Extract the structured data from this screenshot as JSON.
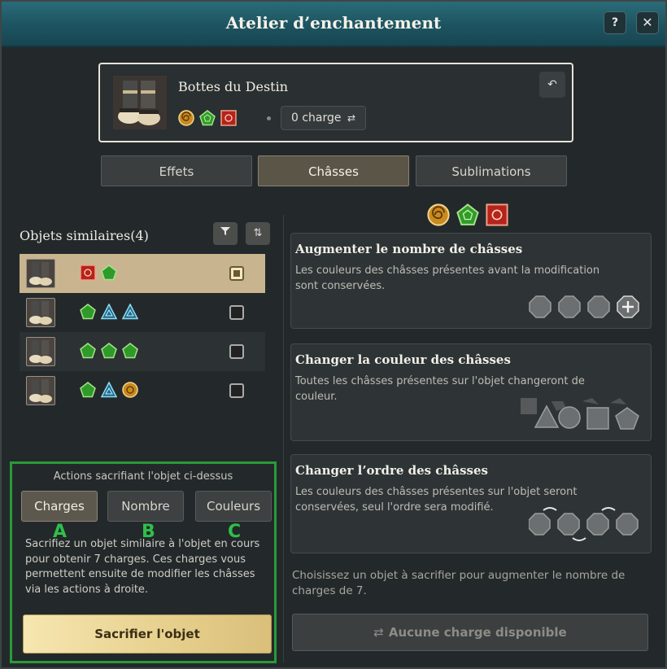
{
  "window": {
    "title": "Atelier d’enchantement",
    "help_label": "?",
    "close_label": "✕"
  },
  "item": {
    "name": "Bottes du Destin",
    "icon": "boots-icon",
    "sockets": [
      "orange-spiral",
      "green-pentagon",
      "red-square"
    ],
    "charge_label": "0 charge",
    "undo_icon": "undo-icon"
  },
  "tabs": [
    {
      "label": "Effets",
      "active": false
    },
    {
      "label": "Châsses",
      "active": true
    },
    {
      "label": "Sublimations",
      "active": false
    }
  ],
  "similar": {
    "title": "Objets similaires(4)",
    "filter_icon": "filter-icon",
    "sort_icon": "sort-icon",
    "items": [
      {
        "sockets": [
          "red-square",
          "green-pentagon"
        ],
        "selected": true
      },
      {
        "sockets": [
          "green-pentagon",
          "blue-triangle",
          "blue-triangle"
        ],
        "selected": false
      },
      {
        "sockets": [
          "green-pentagon",
          "green-pentagon",
          "green-pentagon"
        ],
        "selected": false
      },
      {
        "sockets": [
          "green-pentagon",
          "blue-triangle",
          "orange-spiral"
        ],
        "selected": false
      }
    ]
  },
  "sacrifice": {
    "title": "Actions sacrifiant l'objet ci-dessus",
    "buttons": [
      {
        "label": "Charges",
        "letter": "A",
        "active": true
      },
      {
        "label": "Nombre",
        "letter": "B",
        "active": false
      },
      {
        "label": "Couleurs",
        "letter": "C",
        "active": false
      }
    ],
    "description": "Sacrifiez un objet similaire à l'objet en cours pour obtenir 7 charges. Ces charges vous permettent ensuite de modifier les châsses via les actions à droite.",
    "main_button": "Sacrifier l'objet"
  },
  "options": [
    {
      "title": "Augmenter le nombre de châsses",
      "description": "Les couleurs des châsses présentes avant la modification sont conservées."
    },
    {
      "title": "Changer la couleur des châsses",
      "description": "Toutes les châsses présentes sur l'objet changeront de couleur."
    },
    {
      "title": "Changer l’ordre des châsses",
      "description": "Les couleurs des châsses présentes sur l'objet seront conservées, seul l'ordre sera modifié."
    }
  ],
  "footer_note": "Choisissez un objet à sacrifier pour augmenter le nombre de charges de 7.",
  "no_charge_button": "Aucune charge disponible",
  "colors": {
    "accent_green": "#2a9a3a",
    "title_teal": "#1d5360",
    "gold": "#e6cf8c"
  }
}
